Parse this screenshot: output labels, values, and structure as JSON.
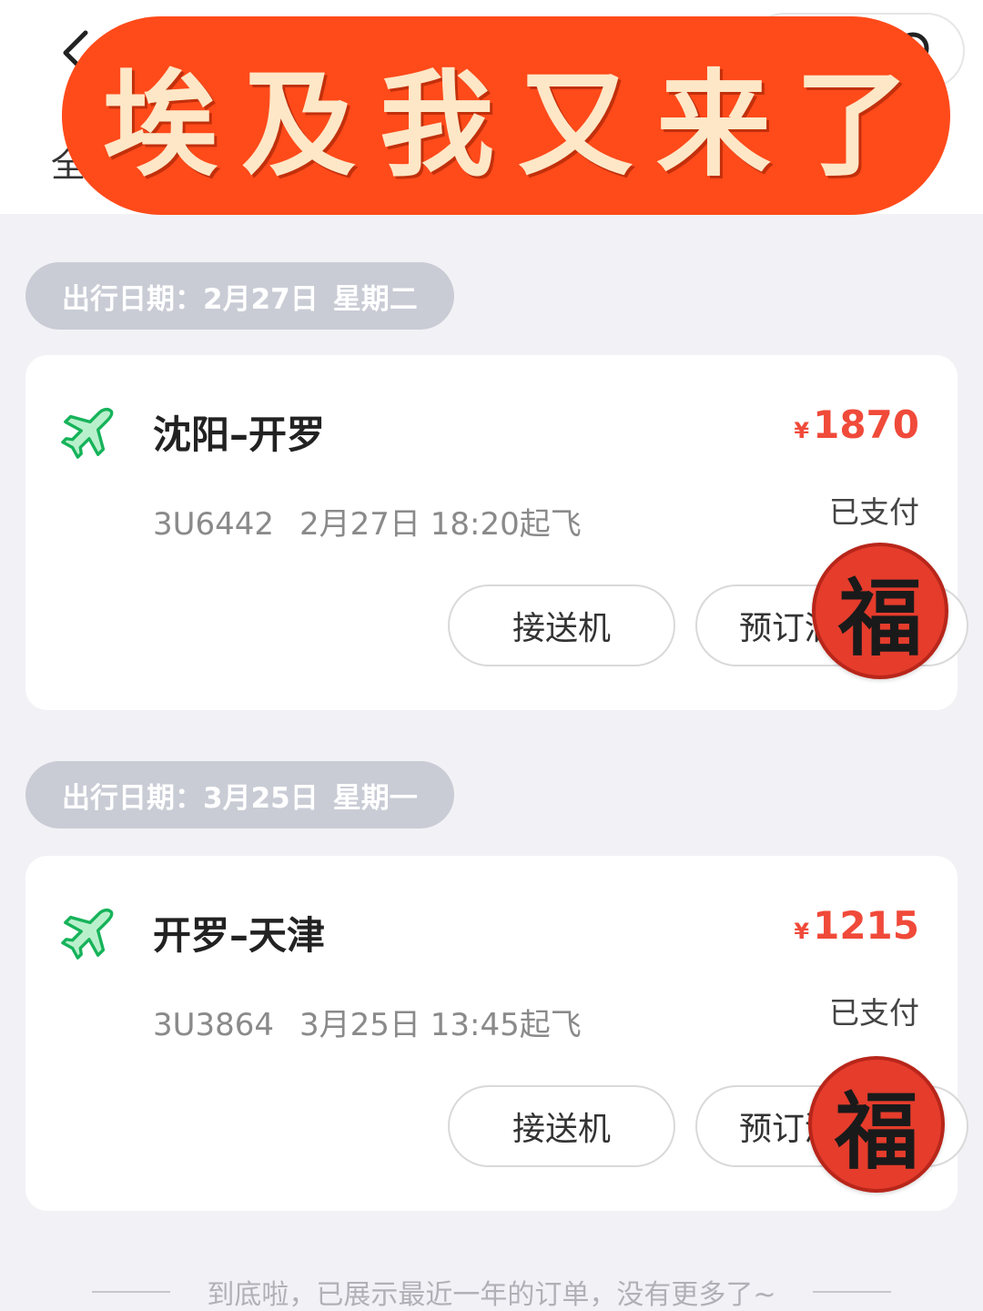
{
  "header": {
    "back_icon": "chevron-left-icon",
    "search_icon": "search-icon",
    "first_tab_label": "全",
    "active_tab_color": "#22c55e"
  },
  "banner": {
    "title": "埃及我又来了"
  },
  "orders": [
    {
      "date_label": "出行日期：",
      "date_value": "2月27日",
      "weekday": "星期二",
      "icon": "airplane-icon",
      "route": "沈阳–开罗",
      "currency": "¥",
      "price": "1870",
      "flight_no": "3U6442",
      "departure": "2月27日 18:20起飞",
      "status": "已支付",
      "transfer_button": "接送机",
      "hotel_button": "预订酒店",
      "sticker": "福"
    },
    {
      "date_label": "出行日期：",
      "date_value": "3月25日",
      "weekday": "星期一",
      "icon": "airplane-icon",
      "route": "开罗–天津",
      "currency": "¥",
      "price": "1215",
      "flight_no": "3U3864",
      "departure": "3月25日 13:45起飞",
      "status": "已支付",
      "transfer_button": "接送机",
      "hotel_button": "预订酒店",
      "sticker": "福"
    }
  ],
  "footer": {
    "text": "到底啦，已展示最近一年的订单，没有更多了~"
  },
  "colors": {
    "price": "#f04a3a",
    "icon_green": "#22c55e",
    "banner_bg": "#ff4a1a",
    "banner_text": "#fde7c7",
    "date_pill": "#c9ccd5",
    "page_bg": "#f2f2f6"
  }
}
